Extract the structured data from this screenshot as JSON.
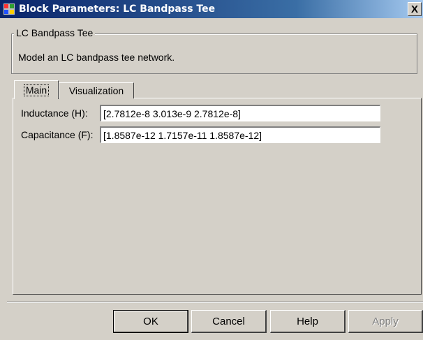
{
  "window": {
    "title": "Block Parameters: LC Bandpass Tee",
    "close_glyph": "X"
  },
  "group": {
    "legend": "LC Bandpass Tee",
    "description": "Model an LC bandpass tee network."
  },
  "tabs": [
    {
      "label": "Main",
      "selected": true
    },
    {
      "label": "Visualization",
      "selected": false
    }
  ],
  "fields": {
    "inductance": {
      "label": "Inductance (H):",
      "value": "[2.7812e-8  3.013e-9  2.7812e-8]"
    },
    "capacitance": {
      "label": "Capacitance (F):",
      "value": "[1.8587e-12  1.7157e-11  1.8587e-12]"
    }
  },
  "buttons": {
    "ok": "OK",
    "cancel": "Cancel",
    "help": "Help",
    "apply": "Apply"
  },
  "icons": {
    "title_icon": "simulink-block-icon"
  },
  "colors": {
    "titlebar_start": "#0a246a",
    "titlebar_end": "#a6caf0",
    "face": "#d4d0c8"
  }
}
